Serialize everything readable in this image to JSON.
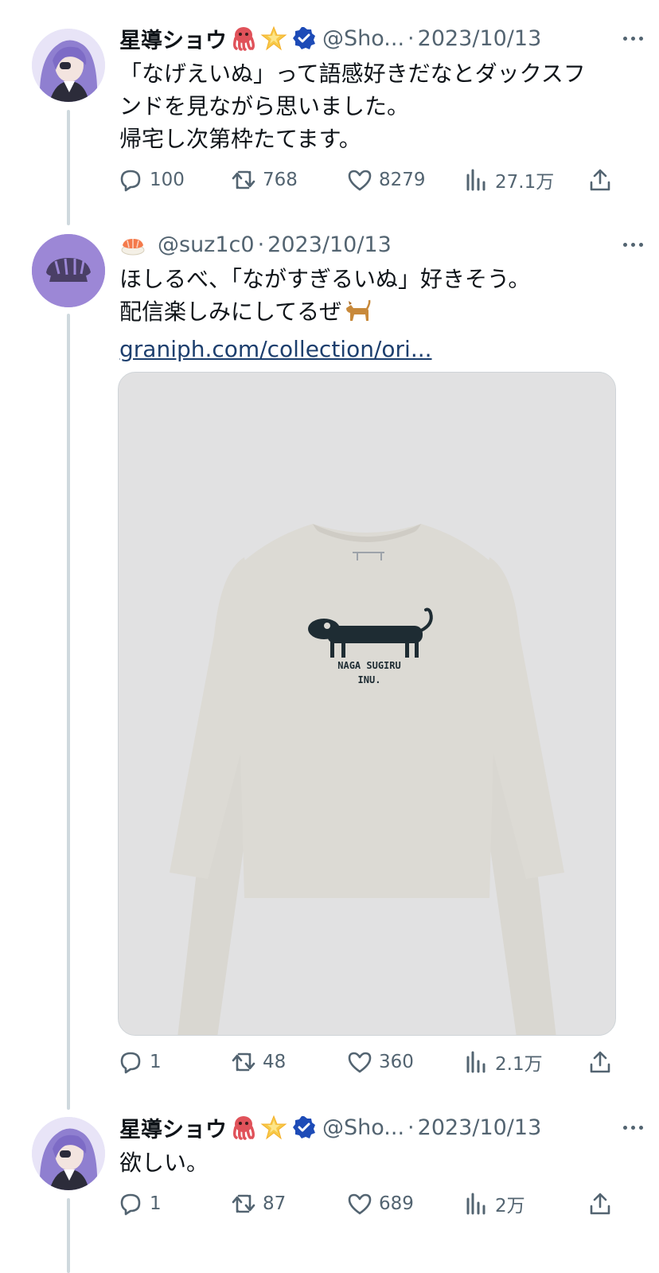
{
  "tweets": [
    {
      "author_name": "星導ショウ",
      "author_emoji_1": "octopus-emoji",
      "author_emoji_2": "glowing-star-emoji",
      "handle": "@Sho...",
      "separator": "·",
      "date": "2023/10/13",
      "text_lines": [
        "「なげえいぬ」って語感好きだなとダックスフ",
        "ンドを見ながら思いました。",
        "帰宅し次第枠たてます。"
      ],
      "replies": "100",
      "retweets": "768",
      "likes": "8279",
      "views": "27.1万"
    },
    {
      "author_emoji": "sushi-emoji",
      "handle": "@suz1c0",
      "separator": "·",
      "date": "2023/10/13",
      "text_lines": [
        "ほしるべ、「ながすぎるいぬ」好きそう。",
        "配信楽しみにしてるぜ"
      ],
      "text_emoji": "dog-emoji",
      "link": "graniph.com/collection/ori...",
      "media_print": [
        "NAGA SUGIRU",
        "INU."
      ],
      "replies": "1",
      "retweets": "48",
      "likes": "360",
      "views": "2.1万"
    },
    {
      "author_name": "星導ショウ",
      "author_emoji_1": "octopus-emoji",
      "author_emoji_2": "glowing-star-emoji",
      "handle": "@Sho...",
      "separator": "·",
      "date": "2023/10/13",
      "text_lines": [
        "欲しい。"
      ],
      "replies": "1",
      "retweets": "87",
      "likes": "689",
      "views": "2万"
    }
  ],
  "colors": {
    "text": "#0f1419",
    "muted": "#536471",
    "verified": "#1d4bb7",
    "link": "#1d3f6e",
    "avatar_purple": "#9c87d6",
    "thread_line": "#cfd9de"
  }
}
